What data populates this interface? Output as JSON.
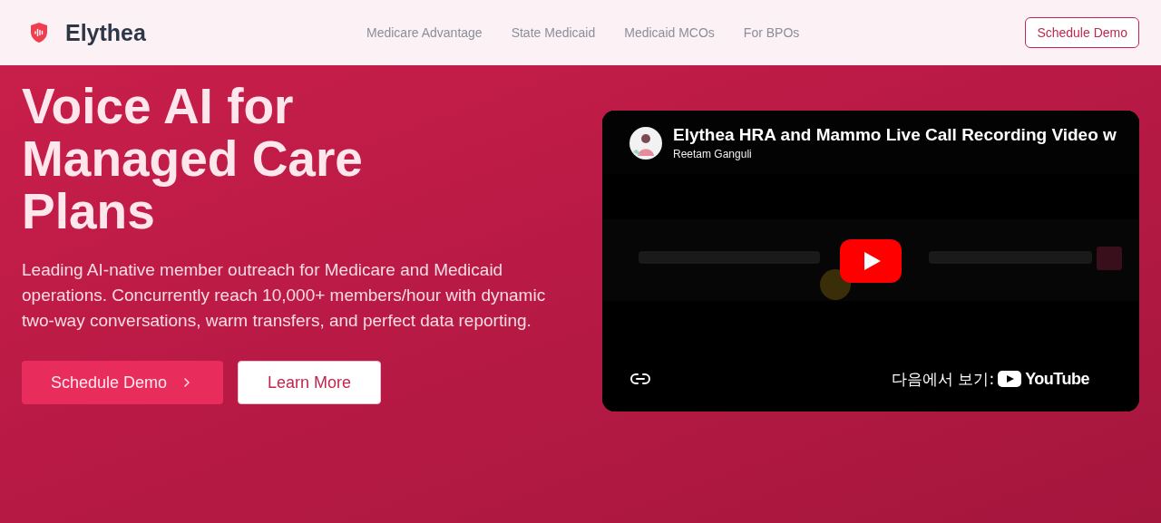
{
  "header": {
    "brand": "Elythea",
    "nav": [
      {
        "label": "Medicare Advantage"
      },
      {
        "label": "State Medicaid"
      },
      {
        "label": "Medicaid MCOs"
      },
      {
        "label": "For BPOs"
      }
    ],
    "cta": "Schedule Demo"
  },
  "hero": {
    "title_lines": [
      "Voice AI for",
      "Managed Care",
      "Plans"
    ],
    "description": "Leading AI-native member outreach for Medicare and Medicaid operations. Concurrently reach 10,000+ members/hour with dynamic two-way conversations, warm transfers, and perfect data reporting.",
    "buttons": [
      {
        "kind": "primary",
        "label": "Schedule Demo"
      },
      {
        "kind": "secondary",
        "label": "Learn More"
      }
    ]
  },
  "video": {
    "kind": "picture",
    "title": "Elythea HRA and Mammo Live Call Recording Video w",
    "channel": "Reetam Ganguli",
    "watch_on": "다음에서 보기:",
    "platform": "YouTube"
  }
}
